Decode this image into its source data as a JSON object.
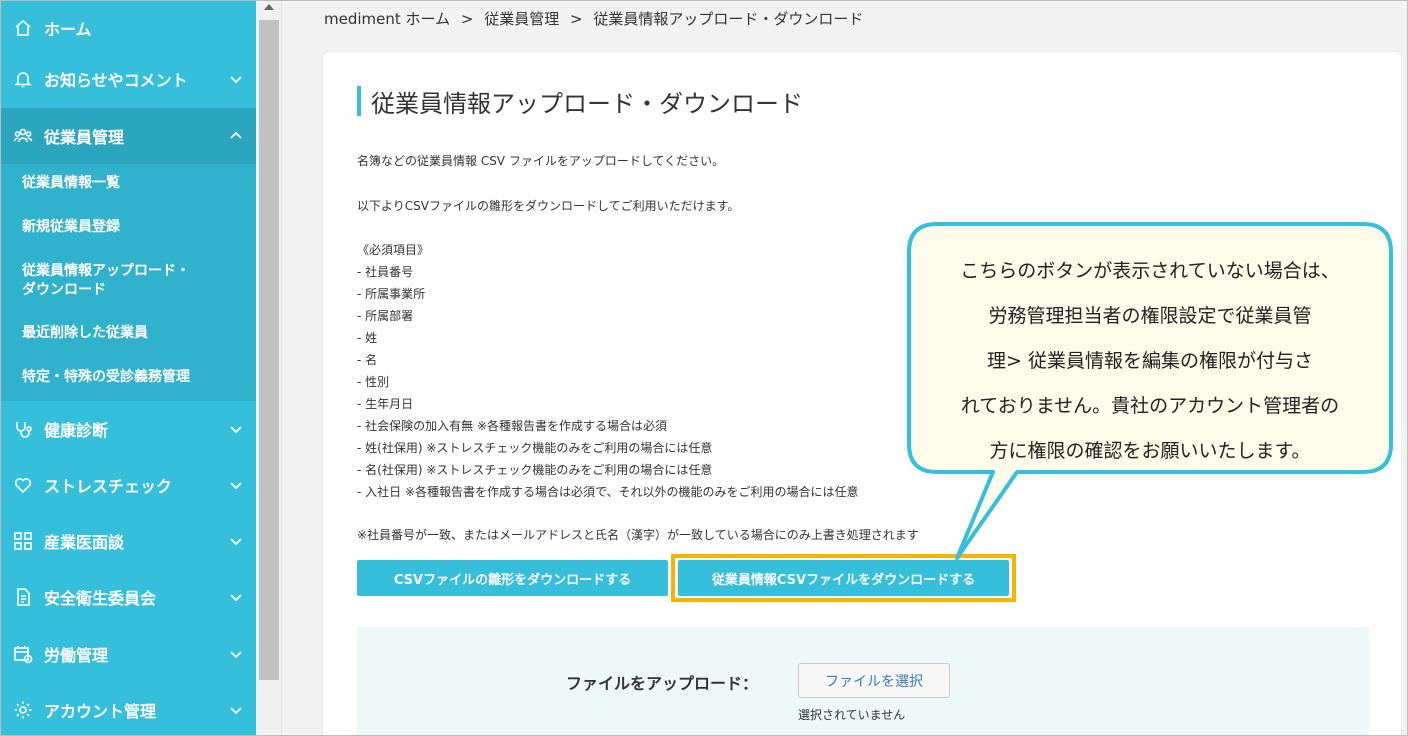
{
  "sidebar": {
    "items": [
      {
        "label": "ホーム",
        "icon": "home-icon"
      },
      {
        "label": "お知らせやコメント",
        "icon": "bell-icon"
      },
      {
        "label": "従業員管理",
        "icon": "people-icon"
      },
      {
        "label": "健康診断",
        "icon": "stethoscope-icon"
      },
      {
        "label": "ストレスチェック",
        "icon": "heart-icon"
      },
      {
        "label": "産業医面談",
        "icon": "interview-icon"
      },
      {
        "label": "安全衛生委員会",
        "icon": "document-icon"
      },
      {
        "label": "労働管理",
        "icon": "calendar-clock-icon"
      },
      {
        "label": "アカウント管理",
        "icon": "gear-icon"
      }
    ],
    "submenu": [
      "従業員情報一覧",
      "新規従業員登録",
      "従業員情報アップロード・",
      "ダウンロード",
      "最近削除した従業員",
      "特定・特殊の受診義務管理"
    ]
  },
  "breadcrumb": {
    "home": "mediment ホーム",
    "sep": ">",
    "level2": "従業員管理",
    "current": "従業員情報アップロード・ダウンロード"
  },
  "page": {
    "title": "従業員情報アップロード・ダウンロード",
    "intro1": "名簿などの従業員情報 CSV ファイルをアップロードしてください。",
    "intro2": "以下よりCSVファイルの雛形をダウンロードしてご利用いただけます。",
    "required_heading": "《必須項目》",
    "required_items": [
      "- 社員番号",
      "- 所属事業所",
      "- 所属部署",
      "- 姓",
      "- 名",
      "- 性別",
      "- 生年月日",
      "- 社会保険の加入有無 ※各種報告書を作成する場合は必須",
      "- 姓(社保用) ※ストレスチェック機能のみをご利用の場合には任意",
      "- 名(社保用) ※ストレスチェック機能のみをご利用の場合には任意",
      "- 入社日 ※各種報告書を作成する場合は必須で、それ以外の機能のみをご利用の場合には任意"
    ],
    "note": "※社員番号が一致、またはメールアドレスと氏名（漢字）が一致している場合にのみ上書き処理されます",
    "btn_template": "CSVファイルの雛形をダウンロードする",
    "btn_employee": "従業員情報CSVファイルをダウンロードする",
    "upload_label": "ファイルをアップロード：",
    "file_button": "ファイルを選択",
    "file_status": "選択されていません"
  },
  "callout": {
    "lines": [
      "こちらのボタンが表示されていない場合は、",
      "労務管理担当者の権限設定で従業員管",
      "理> 従業員情報を編集の権限が付与さ",
      "れておりません。貴社のアカウント管理者の",
      "方に権限の確認をお願いいたします。"
    ]
  },
  "colors": {
    "accent": "#36bfdb",
    "highlight": "#f5b400",
    "callout_bg": "#fdfbea"
  }
}
